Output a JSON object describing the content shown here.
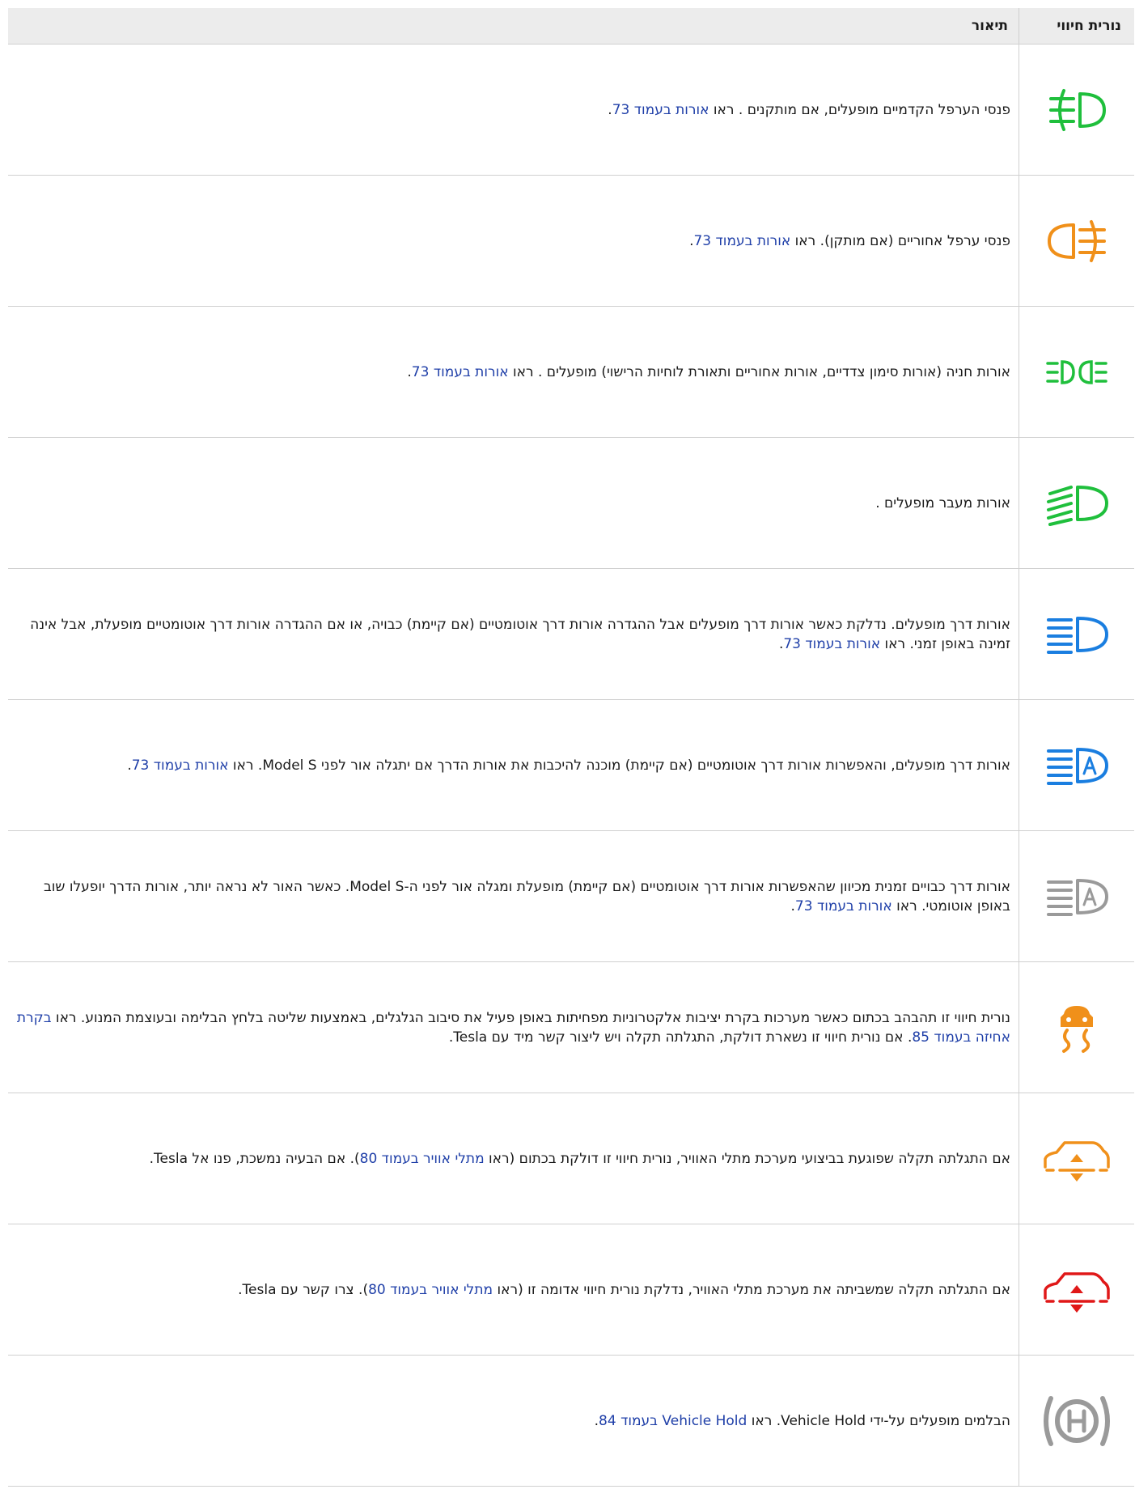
{
  "header": {
    "indicator": "נורית חיווי",
    "description": "תיאור"
  },
  "colors": {
    "green": "#1fbf3c",
    "orange": "#f0901a",
    "blue": "#1a7ee0",
    "grey": "#9a9a9a",
    "red": "#e01818",
    "link": "#1f3fa8"
  },
  "rows": [
    {
      "icon": "front-fog-lights-icon",
      "color": "green",
      "parts": [
        {
          "t": "פנסי הערפל הקדמיים מופעלים, אם מותקנים . ראו "
        },
        {
          "t": "אורות בעמוד 73",
          "link": true
        },
        {
          "t": "."
        }
      ]
    },
    {
      "icon": "rear-fog-lights-icon",
      "color": "orange",
      "parts": [
        {
          "t": "פנסי ערפל אחוריים (אם מותקן). ראו "
        },
        {
          "t": "אורות בעמוד 73",
          "link": true
        },
        {
          "t": "."
        }
      ]
    },
    {
      "icon": "parking-lights-icon",
      "color": "green",
      "parts": [
        {
          "t": "אורות חניה (אורות סימון צדדיים, אורות אחוריים ותאורת לוחיות הרישוי) מופעלים . ראו "
        },
        {
          "t": "אורות בעמוד 73",
          "link": true
        },
        {
          "t": "."
        }
      ]
    },
    {
      "icon": "low-beam-icon",
      "color": "green",
      "parts": [
        {
          "t": "אורות מעבר מופעלים ."
        }
      ]
    },
    {
      "icon": "high-beam-icon",
      "color": "blue",
      "parts": [
        {
          "t": "אורות דרך מופעלים. נדלקת כאשר אורות דרך מופעלים אבל ההגדרה אורות דרך אוטומטיים (אם קיימת) כבויה, או אם ההגדרה אורות דרך אוטומטיים מופעלת, אבל אינה זמינה באופן זמני. ראו "
        },
        {
          "t": "אורות בעמוד 73",
          "link": true
        },
        {
          "t": "."
        }
      ]
    },
    {
      "icon": "auto-high-beam-icon",
      "color": "blue",
      "parts": [
        {
          "t": "אורות דרך מופעלים, והאפשרות אורות דרך אוטומטיים (אם קיימת) מוכנה להיכבות את אורות הדרך אם יתגלה אור לפני Model S. ראו "
        },
        {
          "t": "אורות בעמוד 73",
          "link": true
        },
        {
          "t": "."
        }
      ]
    },
    {
      "icon": "auto-high-beam-off-icon",
      "color": "grey",
      "parts": [
        {
          "t": "אורות דרך כבויים זמנית מכיוון שהאפשרות אורות דרך אוטומטיים (אם קיימת) מופעלת ומגלה אור לפני ה-Model S. כאשר האור לא נראה יותר, אורות הדרך יופעלו שוב באופן אוטומטי. ראו "
        },
        {
          "t": "אורות בעמוד 73",
          "link": true
        },
        {
          "t": "."
        }
      ]
    },
    {
      "icon": "traction-control-icon",
      "color": "orange",
      "parts": [
        {
          "t": "נורית חיווי זו תהבהב בכתום כאשר מערכות בקרת יציבות אלקטרוניות מפחיתות באופן פעיל את סיבוב הגלגלים, באמצעות שליטה בלחץ הבלימה ובעוצמת המנוע. ראו "
        },
        {
          "t": "בקרת אחיזה בעמוד 85",
          "link": true
        },
        {
          "t": ". אם נורית חיווי זו נשארת דולקת, התגלתה תקלה ויש ליצור קשר מיד עם Tesla."
        }
      ]
    },
    {
      "icon": "air-suspension-warning-icon",
      "color": "orange",
      "parts": [
        {
          "t": "אם התגלתה תקלה שפוגעת בביצועי מערכת מתלי האוויר, נורית חיווי זו דולקת בכתום (ראו "
        },
        {
          "t": "מתלי אוויר בעמוד 80",
          "link": true
        },
        {
          "t": "). אם הבעיה נמשכת, פנו אל Tesla."
        }
      ]
    },
    {
      "icon": "air-suspension-fault-icon",
      "color": "red",
      "parts": [
        {
          "t": "אם התגלתה תקלה שמשביתה את מערכת מתלי האוויר, נדלקת נורית חיווי אדומה זו (ראו "
        },
        {
          "t": "מתלי אוויר בעמוד 80",
          "link": true
        },
        {
          "t": "). צרו קשר עם Tesla."
        }
      ]
    },
    {
      "icon": "vehicle-hold-icon",
      "color": "grey",
      "parts": [
        {
          "t": "הבלמים מופעלים על-ידי Vehicle Hold. ראו "
        },
        {
          "t": "Vehicle Hold בעמוד 84",
          "link": true
        },
        {
          "t": "."
        }
      ]
    }
  ]
}
